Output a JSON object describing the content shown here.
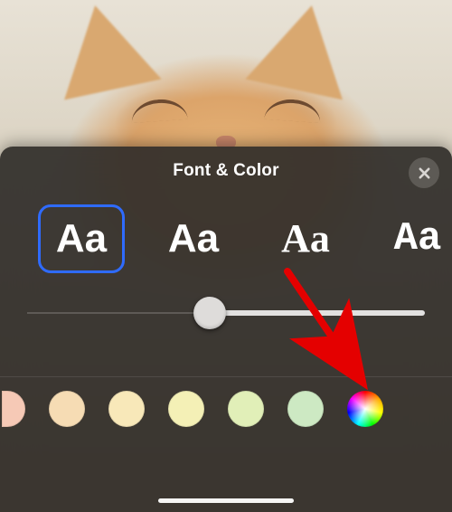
{
  "sheet": {
    "title": "Font & Color",
    "close_aria": "Close"
  },
  "fonts": {
    "sample": "Aa",
    "selected_index": 0,
    "options_count": 4
  },
  "slider": {
    "value_percent": 46
  },
  "colors": {
    "swatches": [
      "#f6c9b6",
      "#f6dcb4",
      "#f8e8b9",
      "#f4f0b6",
      "#e1efb8",
      "#cde9c3"
    ],
    "custom_label": "custom-color-wheel"
  },
  "annotation": {
    "target": "custom-color-wheel"
  }
}
